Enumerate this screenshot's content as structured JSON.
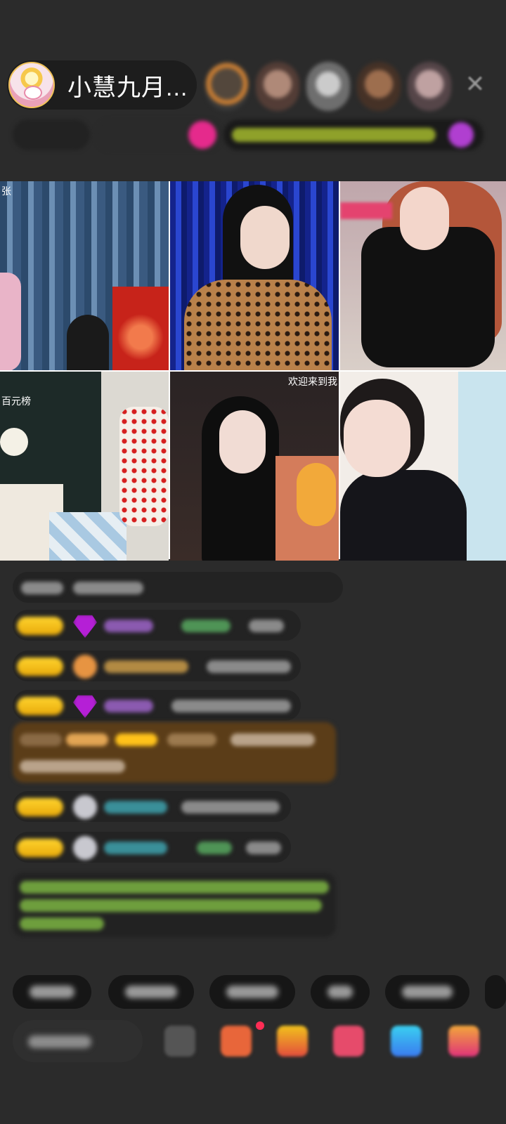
{
  "header": {
    "host_name": "小慧九月...",
    "close_icon": "close-icon",
    "viewer_avatars": [
      "viewer-1",
      "viewer-2",
      "viewer-3",
      "viewer-4",
      "viewer-5"
    ]
  },
  "grid": {
    "tiles": [
      {
        "overlay": "张"
      },
      {
        "overlay": ""
      },
      {
        "overlay": ""
      },
      {
        "overlay": "百元榜"
      },
      {
        "overlay": "欢迎来到我"
      },
      {
        "overlay": ""
      }
    ]
  },
  "colors": {
    "background": "#2b2b2b",
    "badge_gold": "#ffd42e",
    "highlight_bg": "#5b3d18",
    "system_text": "#6e9e3d",
    "notify_dot": "#ff2d55"
  }
}
